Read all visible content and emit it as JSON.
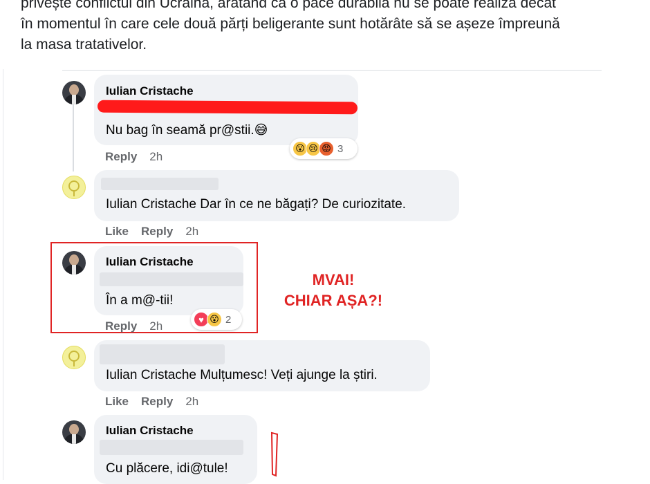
{
  "post": {
    "line1": "privește conflictul din Ucraina, arătând că o pace durabilă nu se poate realiza decât",
    "line2": "în momentul în care cele două părți beligerante sunt hotărâte să se așeze împreună",
    "line3": "la masa tratativelor."
  },
  "comments": [
    {
      "author": "Iulian Cristache",
      "text": "Nu bag în seamă pr@stii.😅",
      "actions": {
        "reply": "Reply",
        "time": "2h"
      },
      "reactions": {
        "icons": [
          "wow-emoji",
          "sad-emoji",
          "angry-emoji"
        ],
        "count": "3"
      }
    },
    {
      "author": "",
      "text": "Iulian Cristache Dar în ce ne băgați? De curiozitate.",
      "actions": {
        "like": "Like",
        "reply": "Reply",
        "time": "2h"
      }
    },
    {
      "author": "Iulian Cristache",
      "text": "În a m@-tii!",
      "actions": {
        "reply": "Reply",
        "time": "2h"
      },
      "reactions": {
        "icons": [
          "love-emoji",
          "wow-emoji"
        ],
        "count": "2"
      }
    },
    {
      "author": "",
      "text": "Iulian Cristache Mulțumesc! Veți ajunge la știri.",
      "actions": {
        "like": "Like",
        "reply": "Reply",
        "time": "2h"
      }
    },
    {
      "author": "Iulian Cristache",
      "text": "Cu plăcere, idi@tule!"
    }
  ],
  "annotation": {
    "line1": "MVAI!",
    "line2": "CHIAR AȘA?!"
  },
  "colors": {
    "bubble": "#f0f2f5",
    "annotation_red": "#e02424",
    "meta_gray": "#65676b"
  }
}
